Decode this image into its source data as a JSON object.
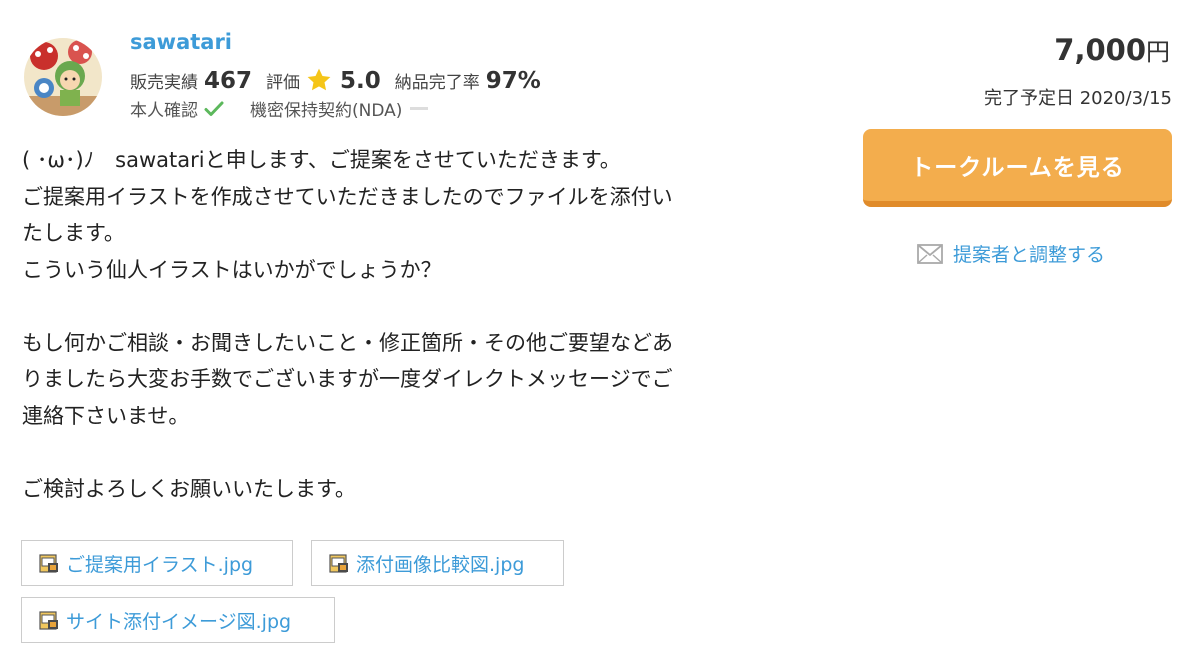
{
  "seller": {
    "username": "sawatari",
    "sales_label": "販売実績",
    "sales_value": "467",
    "rating_label": "評価",
    "rating_value": "5.0",
    "delivery_label": "納品完了率",
    "delivery_value": "97%",
    "identity_label": "本人確認",
    "nda_label": "機密保持契約(NDA)"
  },
  "offer": {
    "price": "7,000",
    "currency": "円",
    "due_date": "完了予定日 2020/3/15",
    "talk_button": "トークルームを見る",
    "contact_link": "提案者と調整する"
  },
  "message": {
    "line1": "( ･ω･)ﾉ　sawatariと申します、ご提案をさせていただきます。",
    "line2": "ご提案用イラストを作成させていただきましたのでファイルを添付い",
    "line3": "たします。",
    "line4": "こういう仙人イラストはいかがでしょうか？",
    "line5": "もし何かご相談・お聞きしたいこと・修正箇所・その他ご要望などあ",
    "line6": "りましたら大変お手数でございますが一度ダイレクトメッセージでご",
    "line7": "連絡下さいませ。",
    "line8": "ご検討よろしくお願いいたします。"
  },
  "attachments": [
    {
      "name": "ご提案用イラスト.jpg"
    },
    {
      "name": "添付画像比較図.jpg"
    },
    {
      "name": "サイト添付イメージ図.jpg"
    }
  ],
  "colors": {
    "link": "#3d9bd8",
    "button": "#f3ad4d",
    "check": "#5cb85c",
    "star": "#f5c518"
  }
}
